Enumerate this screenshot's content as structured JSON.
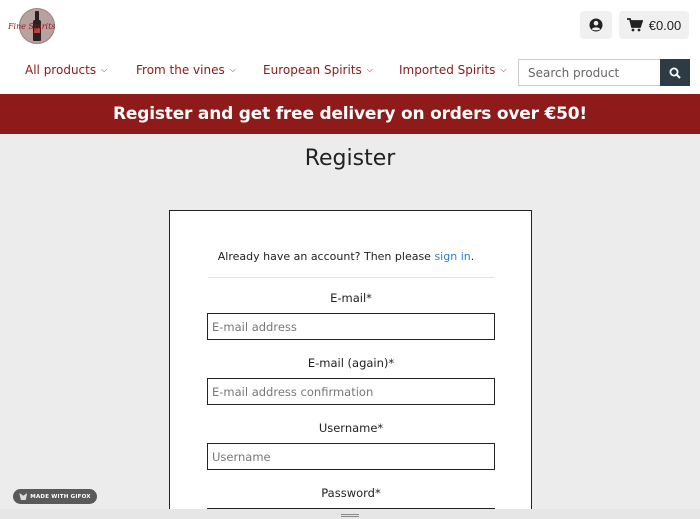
{
  "header": {
    "logo_text": "Fine Spirits",
    "cart_total": "€0.00"
  },
  "nav": {
    "items": [
      {
        "label": "All products"
      },
      {
        "label": "From the vines"
      },
      {
        "label": "European Spirits"
      },
      {
        "label": "Imported Spirits"
      }
    ]
  },
  "search": {
    "placeholder": "Search product"
  },
  "banner": {
    "text": "Register and get free delivery on orders over €50!"
  },
  "page": {
    "title": "Register"
  },
  "form": {
    "signin_prefix": "Already have an account? Then please",
    "signin_link": "sign in",
    "signin_suffix": ".",
    "fields": [
      {
        "label": "E-mail*",
        "placeholder": "E-mail address",
        "value": ""
      },
      {
        "label": "E-mail (again)*",
        "placeholder": "E-mail address confirmation",
        "value": ""
      },
      {
        "label": "Username*",
        "placeholder": "Username",
        "value": ""
      },
      {
        "label": "Password*",
        "placeholder": "",
        "value": ""
      }
    ]
  },
  "badge": {
    "text": "MADE WITH GIFOX"
  },
  "colors": {
    "brand": "#8e1a1a",
    "link": "#2a7fd1",
    "search_button": "#2d3b45"
  },
  "icons": {
    "account": "user-circle-icon",
    "cart": "shopping-cart-icon",
    "search": "search-icon",
    "chevron": "chevron-down-icon"
  }
}
